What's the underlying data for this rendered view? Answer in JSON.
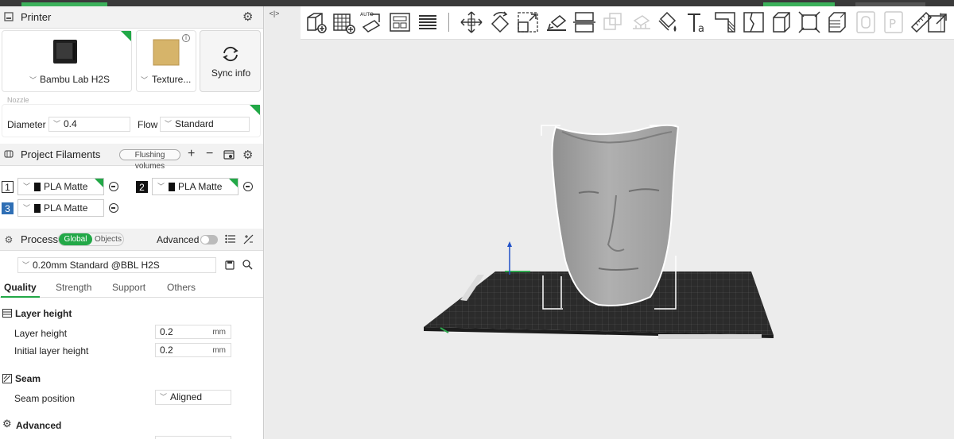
{
  "printer": {
    "section_title": "Printer",
    "printer_name": "Bambu Lab H2S",
    "plate_name": "Texture...",
    "sync_label": "Sync info",
    "nozzle_label": "Nozzle",
    "diameter_label": "Diameter",
    "diameter_value": "0.4",
    "flow_label": "Flow",
    "flow_value": "Standard"
  },
  "filaments": {
    "section_title": "Project Filaments",
    "flushing_label": "Flushing volumes",
    "items": [
      {
        "number": "1",
        "name": "PLA Matte"
      },
      {
        "number": "2",
        "name": "PLA Matte"
      },
      {
        "number": "3",
        "name": "PLA Matte"
      }
    ]
  },
  "process": {
    "section_title": "Process",
    "toggle_global": "Global",
    "toggle_objects": "Objects",
    "advanced_label": "Advanced",
    "preset": "0.20mm Standard @BBL H2S",
    "tabs": [
      "Quality",
      "Strength",
      "Support",
      "Others"
    ],
    "active_tab": "Quality"
  },
  "params": {
    "layer_height_group": "Layer height",
    "layer_height_label": "Layer height",
    "layer_height_value": "0.2",
    "layer_height_unit": "mm",
    "initial_layer_label": "Initial layer height",
    "initial_layer_value": "0.2",
    "initial_layer_unit": "mm",
    "seam_group": "Seam",
    "seam_position_label": "Seam position",
    "seam_position_value": "Aligned",
    "advanced_group": "Advanced"
  },
  "colors": {
    "accent": "#22a847",
    "filament_black": "#111111",
    "filament3_number_bg": "#2f6fb5"
  },
  "toolbar": {
    "icons": [
      "add-object-icon",
      "arrange-grid-icon",
      "auto-orient-icon",
      "split-plates-icon",
      "layers-icon",
      "move-icon",
      "rotate-icon",
      "scale-icon",
      "lay-on-face-icon",
      "cut-icon",
      "mesh-boolean-icon",
      "support-paint-icon",
      "color-paint-icon",
      "text-icon",
      "variable-height-icon",
      "seam-paint-icon",
      "assembly-icon",
      "measure-box-icon",
      "fuzzy-skin-icon",
      "brim-ears-icon",
      "slice-view-icon",
      "ruler-icon",
      "export-icon"
    ]
  }
}
